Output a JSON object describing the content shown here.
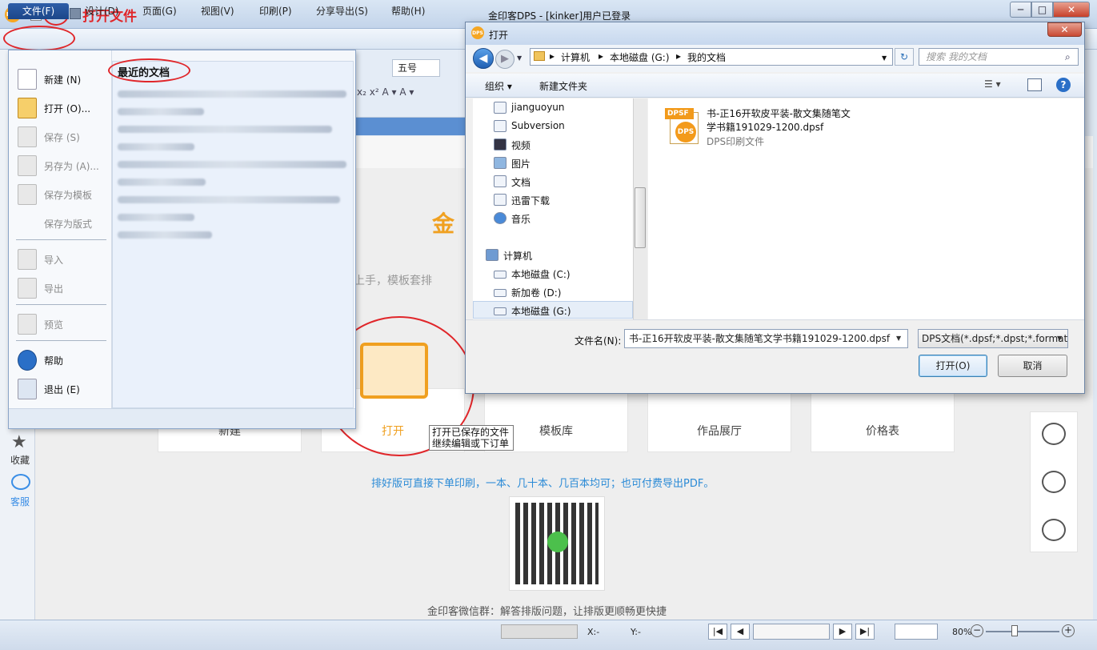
{
  "titlebar": {
    "logo": "DPS",
    "title": "金印客DPS - [kinker]用户已登录",
    "annotation": "打开文件",
    "min": "─",
    "max": "□",
    "close": "✕"
  },
  "menubar": {
    "items": [
      "文件(F)",
      "设计(D)",
      "页面(G)",
      "视图(V)",
      "印刷(P)",
      "分享导出(S)",
      "帮助(H)"
    ]
  },
  "ribbon_hint": {
    "font_size": "五号",
    "format_glyphs": "x₂ x² A ▾ A ▾"
  },
  "file_menu": {
    "items": [
      {
        "label": "新建 (N)",
        "icon": "new-doc-icon",
        "enabled": true
      },
      {
        "label": "打开 (O)...",
        "icon": "folder-open-icon",
        "enabled": true
      },
      {
        "label": "保存 (S)",
        "icon": "save-icon",
        "enabled": false
      },
      {
        "label": "另存为 (A)...",
        "icon": "save-as-icon",
        "enabled": false
      },
      {
        "label": "保存为模板",
        "icon": "save-template-icon",
        "enabled": false
      },
      {
        "label": "保存为版式",
        "icon": "",
        "enabled": false
      },
      {
        "label": "导入",
        "icon": "import-icon",
        "enabled": false
      },
      {
        "label": "导出",
        "icon": "export-icon",
        "enabled": false
      },
      {
        "label": "预览",
        "icon": "preview-icon",
        "enabled": false
      },
      {
        "label": "帮助",
        "icon": "help-icon",
        "enabled": true
      },
      {
        "label": "退出 (E)",
        "icon": "exit-icon",
        "enabled": true
      }
    ],
    "recent_title": "最近的文档"
  },
  "sidebar": {
    "favorites": "收藏",
    "service": "客服",
    "favorites_icon": "★"
  },
  "main": {
    "tagline": "易上手，模板套排",
    "brand_char": "金",
    "cards": [
      "新建",
      "打开",
      "模板库",
      "作品展厅",
      "价格表"
    ],
    "tooltip_line1": "打开已保存的文件",
    "tooltip_line2": "继续编辑或下订单",
    "note": "排好版可直接下单印刷，一本、几十本、几百本均可；也可付费导出PDF。",
    "wechat_group": "金印客微信群：解答排版问题，让排版更顺畅更快捷"
  },
  "statusbar": {
    "x_label": "X:-",
    "y_label": "Y:-",
    "zoom": "80%",
    "first": "|◀",
    "prev": "◀",
    "next": "▶",
    "last": "▶|",
    "minus": "−",
    "plus": "+"
  },
  "dialog": {
    "title": "打开",
    "close": "✕",
    "breadcrumbs": [
      "计算机",
      "本地磁盘 (G:)",
      "我的文档"
    ],
    "search_placeholder": "搜索 我的文档",
    "organize": "组织 ▾",
    "new_folder": "新建文件夹",
    "help": "?",
    "tree": [
      {
        "label": "jianguoyun",
        "icon": "folder-icon"
      },
      {
        "label": "Subversion",
        "icon": "folder-icon"
      },
      {
        "label": "视频",
        "icon": "video-icon"
      },
      {
        "label": "图片",
        "icon": "picture-icon"
      },
      {
        "label": "文档",
        "icon": "document-icon"
      },
      {
        "label": "迅雷下载",
        "icon": "folder-icon"
      },
      {
        "label": "音乐",
        "icon": "music-icon"
      },
      {
        "label": "计算机",
        "icon": "computer-icon"
      },
      {
        "label": "本地磁盘 (C:)",
        "icon": "drive-icon"
      },
      {
        "label": "新加卷 (D:)",
        "icon": "drive-icon"
      },
      {
        "label": "本地磁盘 (G:)",
        "icon": "drive-icon"
      }
    ],
    "file": {
      "band": "DPSF",
      "badge": "DPS",
      "name_line1": "书-正16开软皮平装-散文集随笔文",
      "name_line2": "学书籍191029-1200.dpsf",
      "type": "DPS印刷文件"
    },
    "filename_label": "文件名(N):",
    "filename_value": "书-正16开软皮平装-散文集随笔文学书籍191029-1200.dpsf",
    "filetype_value": "DPS文档(*.dpsf;*.dpst;*.format",
    "open_button": "打开(O)",
    "cancel_button": "取消"
  },
  "colors": {
    "accent_blue": "#1c4689",
    "annotation_red": "#e0262a",
    "brand_orange": "#f0a020",
    "link_blue": "#2a8ad6"
  }
}
